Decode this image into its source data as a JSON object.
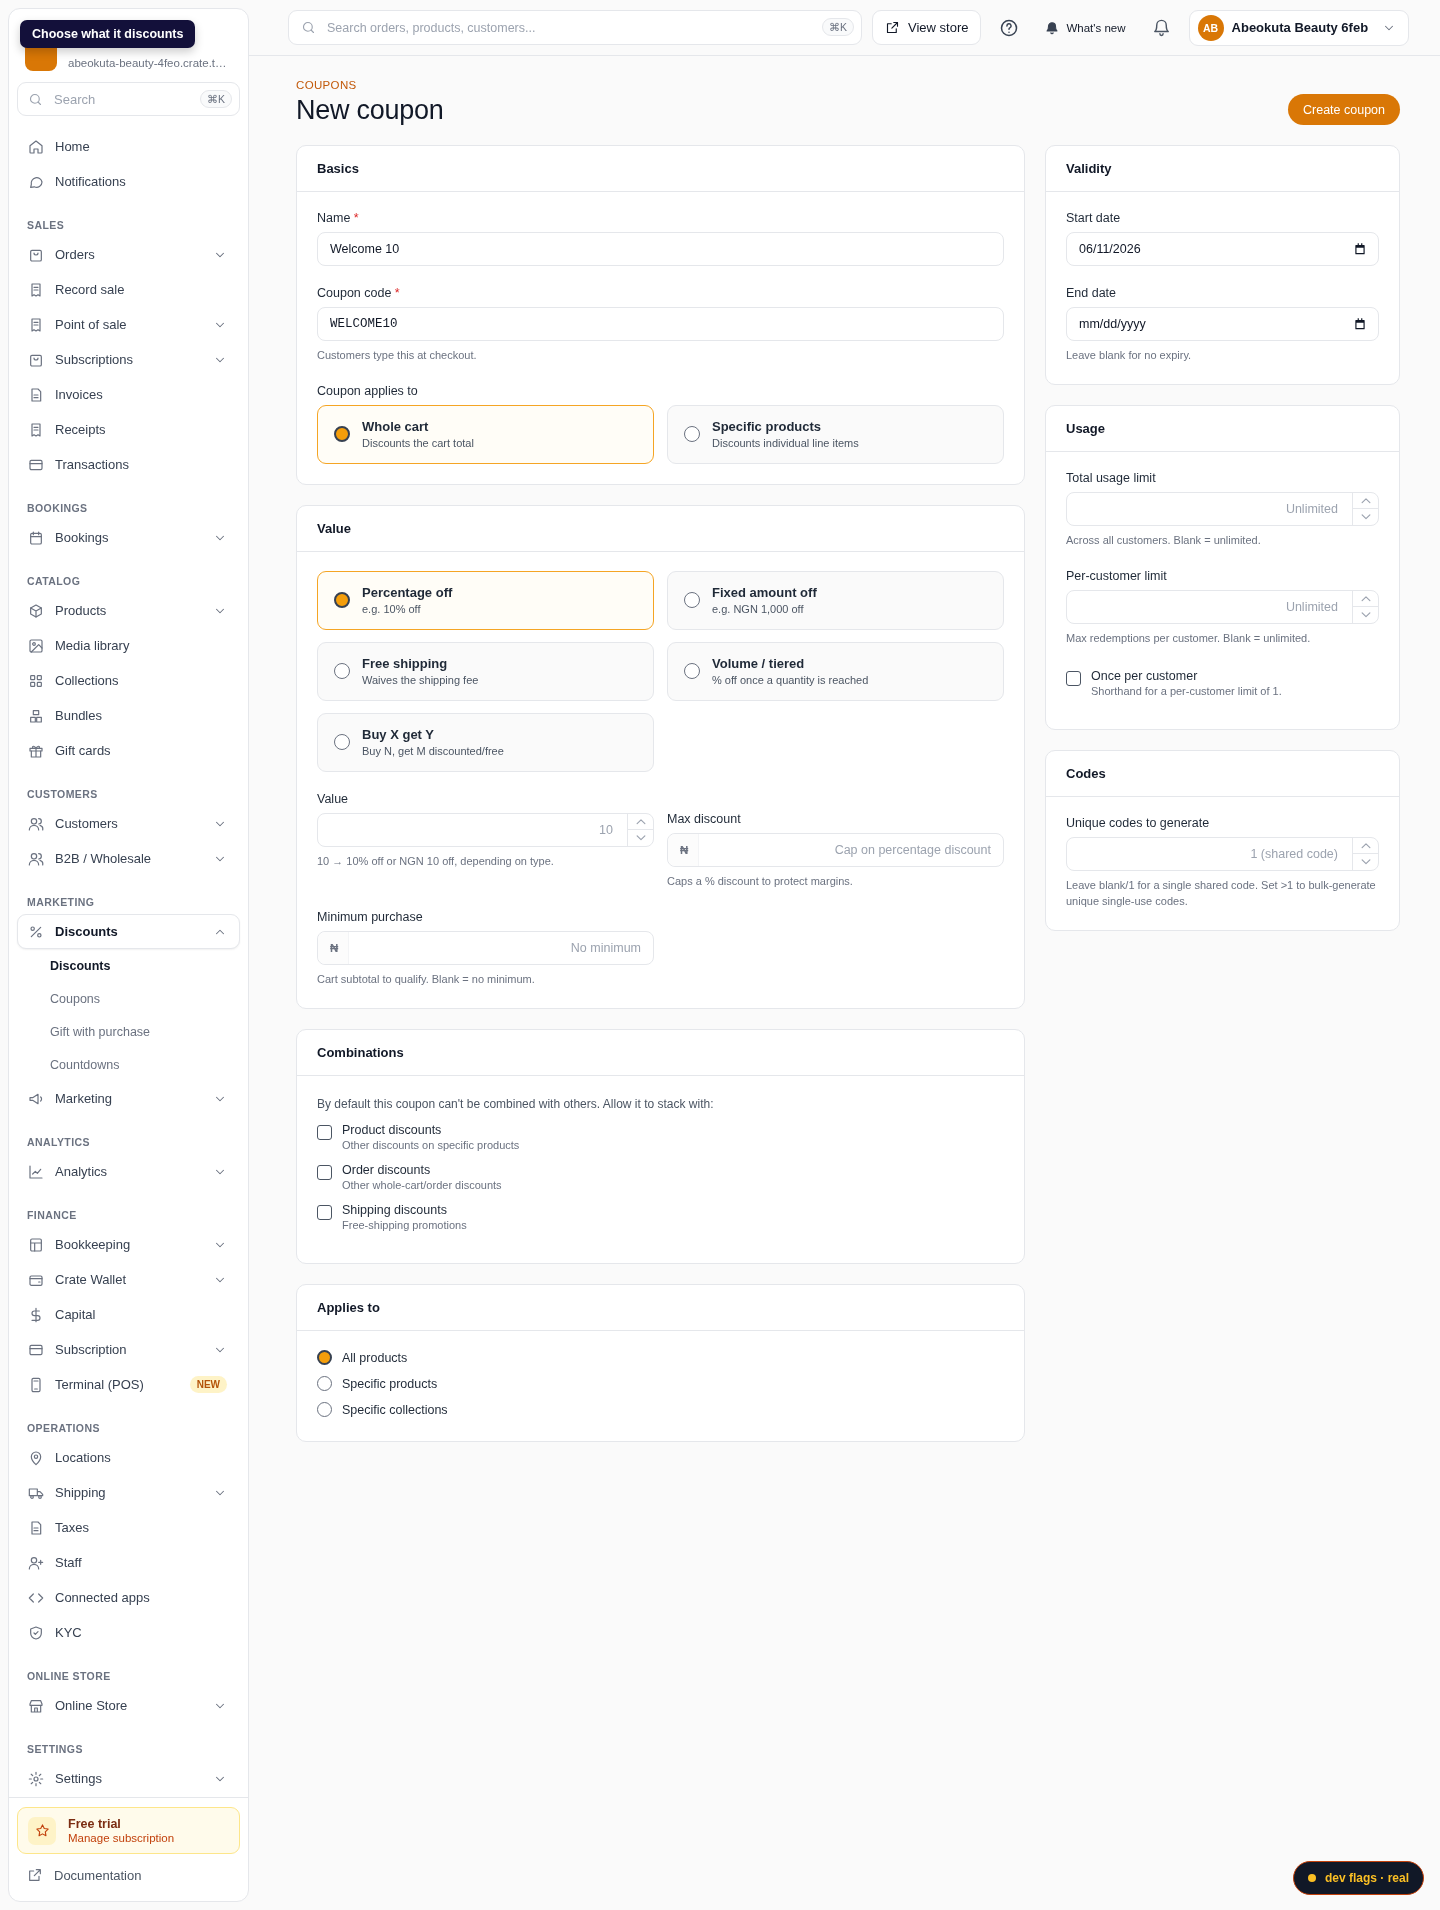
{
  "tooltip": {
    "text": "Choose what it discounts"
  },
  "store": {
    "subtitle": "abeokuta-beauty-4feo.crate.t…"
  },
  "sidebar": {
    "search": {
      "placeholder": "Search",
      "shortcut": "⌘K"
    },
    "sections": [
      {
        "items": [
          {
            "label": "Home",
            "selected": false
          },
          {
            "label": "Notifications",
            "selected": false
          }
        ]
      },
      {
        "label": "SALES",
        "items": [
          {
            "label": "Orders",
            "selected": false,
            "expanded": false
          },
          {
            "label": "Record sale",
            "selected": false
          },
          {
            "label": "Point of sale",
            "selected": false,
            "expanded": false
          },
          {
            "label": "Subscriptions",
            "selected": false,
            "expanded": false
          },
          {
            "label": "Invoices",
            "selected": false
          },
          {
            "label": "Receipts",
            "selected": false
          },
          {
            "label": "Transactions",
            "selected": false
          }
        ]
      },
      {
        "label": "BOOKINGS",
        "items": [
          {
            "label": "Bookings",
            "selected": false,
            "expanded": false
          }
        ]
      },
      {
        "label": "CATALOG",
        "items": [
          {
            "label": "Products",
            "selected": false,
            "expanded": false
          },
          {
            "label": "Media library",
            "selected": false
          },
          {
            "label": "Collections",
            "selected": false
          },
          {
            "label": "Bundles",
            "selected": false
          },
          {
            "label": "Gift cards",
            "selected": false
          }
        ]
      },
      {
        "label": "CUSTOMERS",
        "items": [
          {
            "label": "Customers",
            "selected": false,
            "expanded": false
          },
          {
            "label": "B2B / Wholesale",
            "selected": false,
            "expanded": false
          }
        ]
      },
      {
        "label": "MARKETING",
        "items": [
          {
            "label": "Discounts",
            "selected": true,
            "expanded": true,
            "children": [
              {
                "label": "Discounts",
                "selected": true
              },
              {
                "label": "Coupons",
                "selected": false
              },
              {
                "label": "Gift with purchase",
                "selected": false
              },
              {
                "label": "Countdowns",
                "selected": false
              }
            ]
          },
          {
            "label": "Marketing",
            "selected": false,
            "expanded": false
          }
        ]
      },
      {
        "label": "ANALYTICS",
        "items": [
          {
            "label": "Analytics",
            "selected": false,
            "expanded": false
          }
        ]
      },
      {
        "label": "FINANCE",
        "items": [
          {
            "label": "Bookkeeping",
            "selected": false,
            "expanded": false
          },
          {
            "label": "Crate Wallet",
            "selected": false,
            "expanded": false
          },
          {
            "label": "Capital",
            "selected": false
          },
          {
            "label": "Subscription",
            "selected": false,
            "expanded": false
          },
          {
            "label": "Terminal (POS)",
            "selected": false,
            "badge": "NEW"
          }
        ]
      },
      {
        "label": "OPERATIONS",
        "items": [
          {
            "label": "Locations",
            "selected": false
          },
          {
            "label": "Shipping",
            "selected": false,
            "expanded": false
          },
          {
            "label": "Taxes",
            "selected": false
          },
          {
            "label": "Staff",
            "selected": false
          },
          {
            "label": "Connected apps",
            "selected": false
          },
          {
            "label": "KYC",
            "selected": false
          }
        ]
      },
      {
        "label": "ONLINE STORE",
        "items": [
          {
            "label": "Online Store",
            "selected": false,
            "expanded": false
          }
        ]
      },
      {
        "label": "SETTINGS",
        "items": [
          {
            "label": "Settings",
            "selected": false,
            "expanded": false
          }
        ]
      }
    ],
    "footer": {
      "trial": {
        "title": "Free trial",
        "subtitle": "Manage subscription"
      },
      "documentation": "Documentation"
    }
  },
  "topbar": {
    "search": {
      "placeholder": "Search orders, products, customers...",
      "shortcut": "⌘K"
    },
    "view_store": "View store",
    "whats_new": "What's new",
    "account": {
      "initials": "AB",
      "name": "Abeokuta Beauty 6feb"
    }
  },
  "page": {
    "breadcrumb": "COUPONS",
    "title": "New coupon",
    "primary_action": "Create coupon"
  },
  "basics": {
    "title": "Basics",
    "name": {
      "kind": "text",
      "label": "Name",
      "required_mark": "*",
      "value": "Welcome 10"
    },
    "code": {
      "kind": "code",
      "label": "Coupon code",
      "required_mark": "*",
      "value": "WELCOME10",
      "hint": "Customers type this at checkout."
    },
    "applies": {
      "label": "Coupon applies to",
      "options": [
        {
          "title": "Whole cart",
          "description": "Discounts the cart total",
          "selected": true
        },
        {
          "title": "Specific products",
          "description": "Discounts individual line items",
          "selected": false
        }
      ]
    }
  },
  "value": {
    "title": "Value",
    "types": [
      {
        "title": "Percentage off",
        "description": "e.g. 10% off",
        "selected": true
      },
      {
        "title": "Fixed amount off",
        "description": "e.g. NGN 1,000 off",
        "selected": false
      },
      {
        "title": "Free shipping",
        "description": "Waives the shipping fee",
        "selected": false
      },
      {
        "title": "Volume / tiered",
        "description": "% off once a quantity is reached",
        "selected": false
      },
      {
        "title": "Buy X get Y",
        "description": "Buy N, get M discounted/free",
        "selected": false
      }
    ],
    "amount": {
      "kind": "number",
      "label": "Value",
      "placeholder": "10",
      "hint": "10 → 10% off or NGN 10 off, depending on type."
    },
    "max_discount": {
      "kind": "currency",
      "label": "Max discount",
      "prefix": "₦",
      "placeholder": "Cap on percentage discount",
      "hint": "Caps a % discount to protect margins."
    },
    "minimum_purchase": {
      "kind": "currency",
      "label": "Minimum purchase",
      "prefix": "₦",
      "placeholder": "No minimum",
      "hint": "Cart subtotal to qualify. Blank = no minimum."
    }
  },
  "combinations": {
    "title": "Combinations",
    "intro": "By default this coupon can't be combined with others. Allow it to stack with:",
    "options": [
      {
        "title": "Product discounts",
        "description": "Other discounts on specific products",
        "checked": false
      },
      {
        "title": "Order discounts",
        "description": "Other whole-cart/order discounts",
        "checked": false
      },
      {
        "title": "Shipping discounts",
        "description": "Free-shipping promotions",
        "checked": false
      }
    ]
  },
  "applies_to": {
    "title": "Applies to",
    "options": [
      {
        "label": "All products",
        "selected": true
      },
      {
        "label": "Specific products",
        "selected": false
      },
      {
        "label": "Specific collections",
        "selected": false
      }
    ]
  },
  "validity": {
    "title": "Validity",
    "start": {
      "kind": "date",
      "label": "Start date",
      "value": "06/11/2026"
    },
    "end": {
      "kind": "date",
      "label": "End date",
      "placeholder": "mm/dd/yyyy",
      "hint": "Leave blank for no expiry."
    }
  },
  "usage": {
    "title": "Usage",
    "total": {
      "kind": "number",
      "label": "Total usage limit",
      "placeholder": "Unlimited",
      "hint": "Across all customers. Blank = unlimited."
    },
    "per_customer": {
      "kind": "number",
      "label": "Per-customer limit",
      "placeholder": "Unlimited",
      "hint": "Max redemptions per customer. Blank = unlimited."
    },
    "once": {
      "title": "Once per customer",
      "description": "Shorthand for a per-customer limit of 1.",
      "checked": false
    }
  },
  "codes": {
    "title": "Codes",
    "unique": {
      "kind": "number",
      "label": "Unique codes to generate",
      "placeholder": "1 (shared code)",
      "hint": "Leave blank/1 for a single shared code. Set >1 to bulk-generate unique single-use codes."
    }
  },
  "dev_badge": {
    "text": "dev flags · real"
  }
}
